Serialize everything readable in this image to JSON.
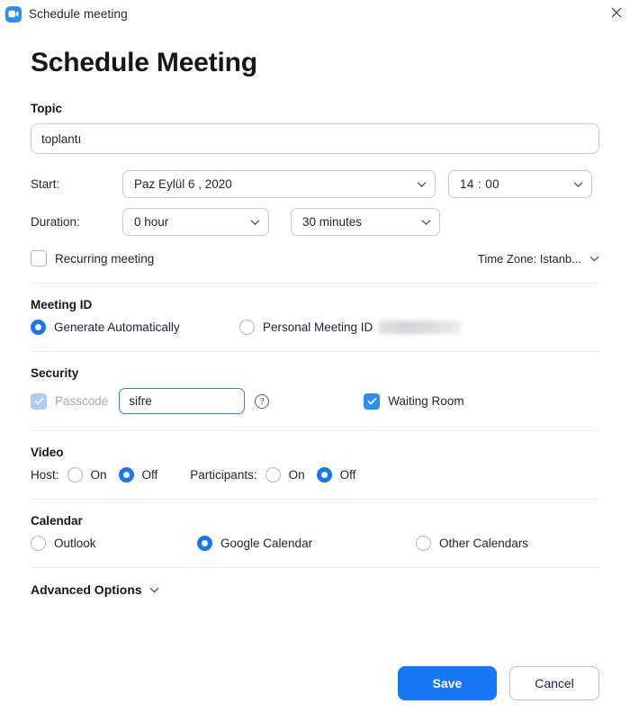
{
  "window": {
    "title": "Schedule meeting",
    "logo_icon": "zoom-camera-icon",
    "close_icon": "close-icon"
  },
  "page": {
    "heading": "Schedule Meeting"
  },
  "topic": {
    "label": "Topic",
    "value": "toplantı"
  },
  "start": {
    "label": "Start:",
    "date_value": "Paz  Eylül  6 ,  2020",
    "time_value": "14 : 00",
    "chevron_icon": "chevron-down-icon"
  },
  "duration": {
    "label": "Duration:",
    "hour_value": "0 hour",
    "minute_value": "30 minutes"
  },
  "recurring": {
    "label": "Recurring meeting",
    "checked": false
  },
  "timezone": {
    "label": "Time Zone: Istanb...",
    "chevron_icon": "chevron-down-icon"
  },
  "meeting_id": {
    "section_label": "Meeting ID",
    "generate_label": "Generate Automatically",
    "personal_label": "Personal Meeting ID",
    "personal_value_redacted": true,
    "selected": "generate"
  },
  "security": {
    "section_label": "Security",
    "passcode_label": "Passcode",
    "passcode_checked": true,
    "passcode_disabled": true,
    "passcode_value": "sifre",
    "help_icon": "question-mark-icon",
    "waiting_room_label": "Waiting Room",
    "waiting_room_checked": true
  },
  "video": {
    "section_label": "Video",
    "host_label": "Host:",
    "host_on_label": "On",
    "host_off_label": "Off",
    "host_selected": "off",
    "participants_label": "Participants:",
    "participants_on_label": "On",
    "participants_off_label": "Off",
    "participants_selected": "off"
  },
  "calendar": {
    "section_label": "Calendar",
    "outlook_label": "Outlook",
    "google_label": "Google Calendar",
    "other_label": "Other Calendars",
    "selected": "google"
  },
  "advanced": {
    "label": "Advanced Options",
    "chevron_icon": "chevron-down-icon"
  },
  "footer": {
    "save_label": "Save",
    "cancel_label": "Cancel"
  },
  "colors": {
    "accent": "#1877F2",
    "logo": "#2D8CFF",
    "checkbox_disabled": "#a8cdf6",
    "border": "#c9c9cf",
    "divider": "#ececed"
  }
}
